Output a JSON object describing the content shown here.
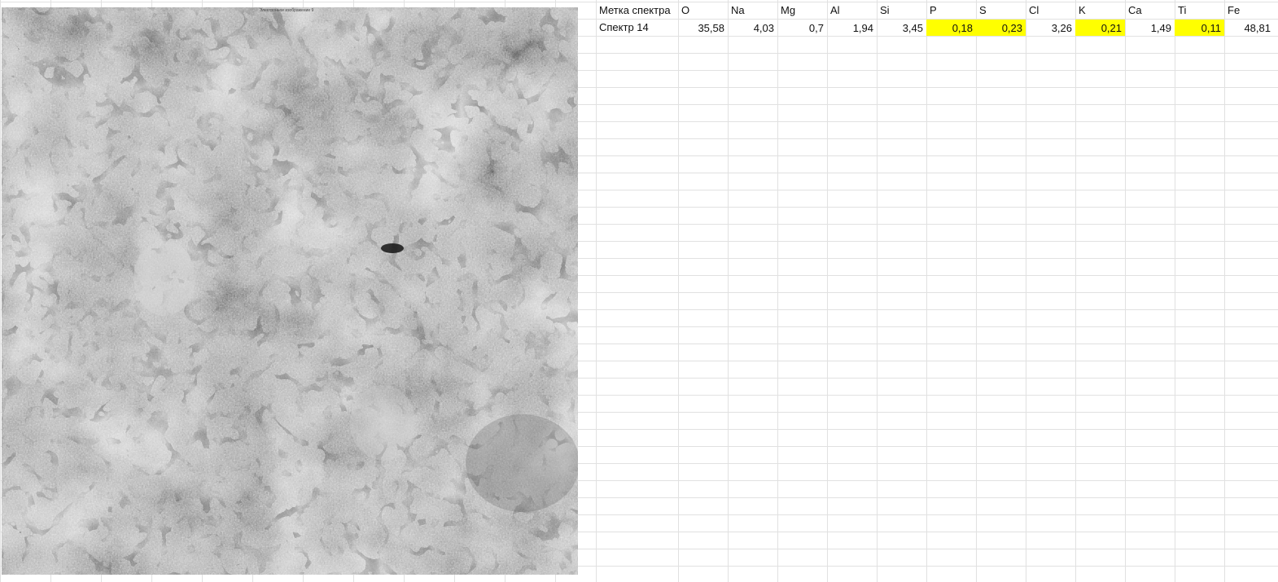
{
  "image": {
    "caption": "Электронное изображение 9"
  },
  "table": {
    "headers": [
      "Метка спектра",
      "O",
      "Na",
      "Mg",
      "Al",
      "Si",
      "P",
      "S",
      "Cl",
      "K",
      "Ca",
      "Ti",
      "Fe"
    ],
    "row": {
      "label": "Спектр 14",
      "values": [
        "35,58",
        "4,03",
        "0,7",
        "1,94",
        "3,45",
        "0,18",
        "0,23",
        "3,26",
        "0,21",
        "1,49",
        "0,11",
        "48,81"
      ],
      "highlighted": [
        false,
        false,
        false,
        false,
        false,
        true,
        true,
        false,
        true,
        false,
        true,
        false
      ]
    }
  },
  "colors": {
    "highlight": "#ffff00",
    "gridline": "#e1e1e1"
  }
}
